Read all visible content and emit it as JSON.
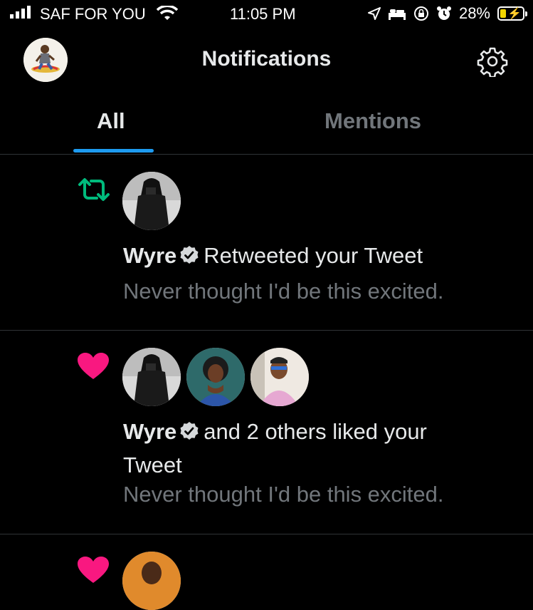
{
  "status_bar": {
    "carrier": "SAF FOR YOU",
    "time": "11:05 PM",
    "battery_percent": "28%",
    "battery_level": 0.28,
    "icons": [
      "signal-icon",
      "wifi-icon",
      "location-icon",
      "bed-icon",
      "rotation-lock-icon",
      "alarm-icon",
      "battery-charging-icon"
    ]
  },
  "header": {
    "title": "Notifications"
  },
  "tabs": [
    {
      "label": "All",
      "selected": true
    },
    {
      "label": "Mentions",
      "selected": false
    }
  ],
  "colors": {
    "background": "#000000",
    "accent": "#1d9bf0",
    "retweet": "#00ba7c",
    "like": "#f91880",
    "muted": "#71767b"
  },
  "notifications": [
    {
      "type": "retweet",
      "icon": "retweet-icon",
      "name": "Wyre",
      "verified": true,
      "action": "Retweeted your Tweet",
      "tweet_text": "Never thought I'd be this excited."
    },
    {
      "type": "like",
      "icon": "heart-icon",
      "name": "Wyre",
      "verified": true,
      "action": "and 2 others liked your",
      "action_line2": "Tweet",
      "tweet_text": "Never thought I'd be this excited."
    },
    {
      "type": "like",
      "icon": "heart-icon"
    }
  ]
}
